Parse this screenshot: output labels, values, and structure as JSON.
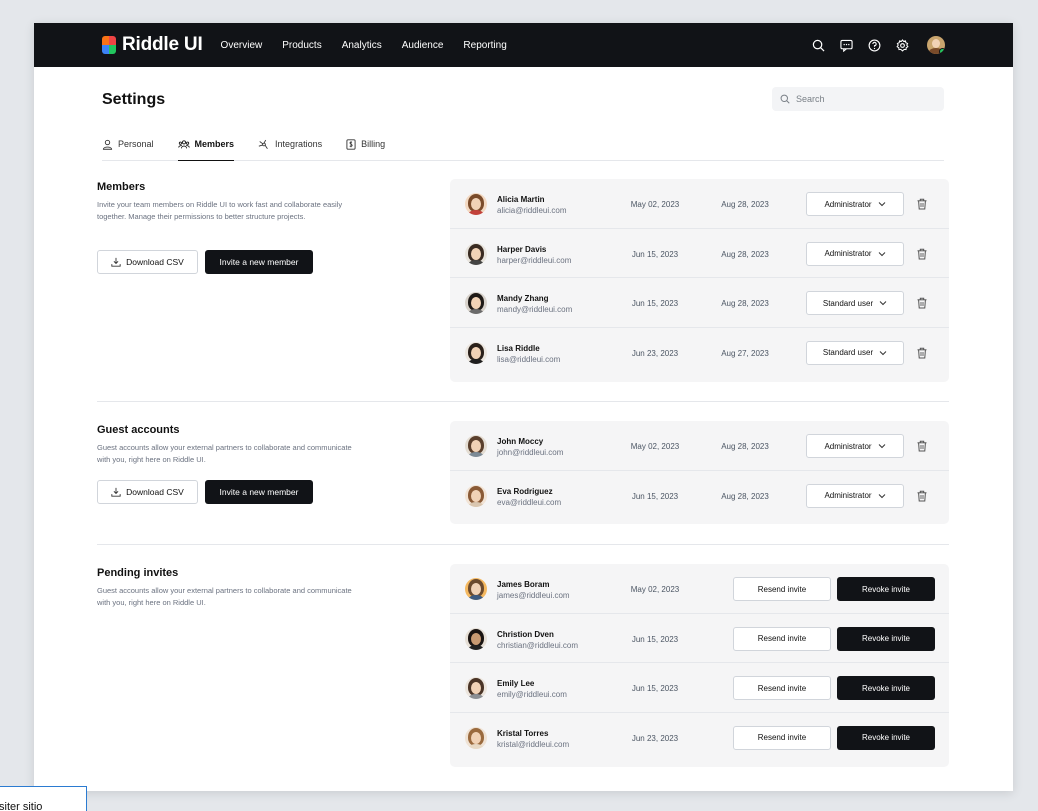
{
  "app": {
    "name": "Riddle UI",
    "nav": [
      "Overview",
      "Products",
      "Analytics",
      "Audience",
      "Reporting"
    ]
  },
  "header": {
    "title": "Settings",
    "search_placeholder": "Search"
  },
  "tabs": [
    {
      "label": "Personal",
      "icon": "person-icon"
    },
    {
      "label": "Members",
      "icon": "team-icon"
    },
    {
      "label": "Integrations",
      "icon": "integrations-icon"
    },
    {
      "label": "Billing",
      "icon": "billing-icon"
    }
  ],
  "members": {
    "title": "Members",
    "description": "Invite your team members on Riddle UI to work fast and collaborate easily together. Manage their permissions to better structure projects.",
    "download_label": "Download CSV",
    "invite_label": "Invite a new member",
    "rows": [
      {
        "name": "Alicia Martin",
        "email": "alicia@riddleui.com",
        "date1": "May 02, 2023",
        "date2": "Aug 28, 2023",
        "role": "Administrator"
      },
      {
        "name": "Harper Davis",
        "email": "harper@riddleui.com",
        "date1": "Jun 15, 2023",
        "date2": "Aug 28, 2023",
        "role": "Administrator"
      },
      {
        "name": "Mandy Zhang",
        "email": "mandy@riddleui.com",
        "date1": "Jun 15, 2023",
        "date2": "Aug 28, 2023",
        "role": "Standard user"
      },
      {
        "name": "Lisa Riddle",
        "email": "lisa@riddleui.com",
        "date1": "Jun 23, 2023",
        "date2": "Aug 27, 2023",
        "role": "Standard user"
      }
    ]
  },
  "guests": {
    "title": "Guest accounts",
    "description": "Guest accounts allow your external partners to collaborate and communicate with you, right here on Riddle UI.",
    "download_label": "Download CSV",
    "invite_label": "Invite a new member",
    "rows": [
      {
        "name": "John Moccy",
        "email": "john@riddleui.com",
        "date1": "May 02, 2023",
        "date2": "Aug 28, 2023",
        "role": "Administrator"
      },
      {
        "name": "Eva Rodriguez",
        "email": "eva@riddleui.com",
        "date1": "Jun 15, 2023",
        "date2": "Aug 28, 2023",
        "role": "Administrator"
      }
    ]
  },
  "pending": {
    "title": "Pending invites",
    "description": "Guest accounts allow your external partners to collaborate and communicate with you, right here on Riddle UI.",
    "resend_label": "Resend invite",
    "revoke_label": "Revoke invite",
    "rows": [
      {
        "name": "James Boram",
        "email": "james@riddleui.com",
        "date1": "May 02, 2023"
      },
      {
        "name": "Christion Dven",
        "email": "christian@riddleui.com",
        "date1": "Jun 15, 2023"
      },
      {
        "name": "Emily Lee",
        "email": "emily@riddleui.com",
        "date1": "Jun 15, 2023"
      },
      {
        "name": "Kristal Torres",
        "email": "kristal@riddleui.com",
        "date1": "Jun 23, 2023"
      }
    ]
  },
  "stray_text": "siter sitio",
  "colors": {
    "navbar": "#111317",
    "dark_button": "#111317",
    "card_bg": "#f5f5f6",
    "status_online": "#22c55e",
    "logo": [
      "#f97316",
      "#22c55e",
      "#3b82f6",
      "#ef4444"
    ]
  }
}
